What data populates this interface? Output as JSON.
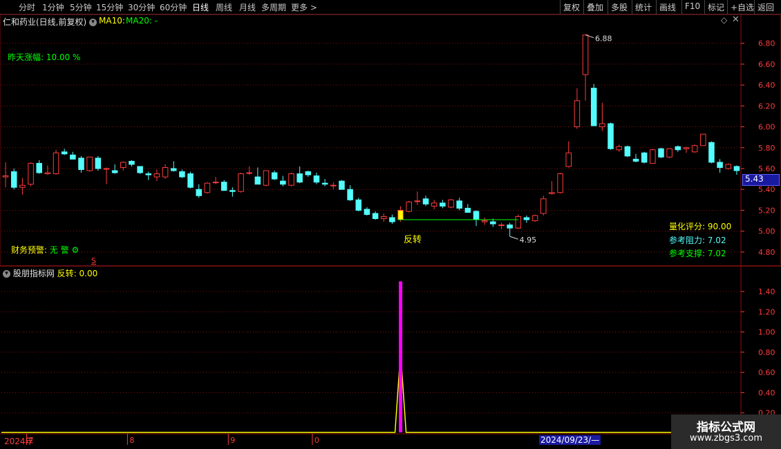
{
  "toolbar": {
    "timeframes": [
      "分时",
      "1分钟",
      "5分钟",
      "15分钟",
      "30分钟",
      "60分钟",
      "日线",
      "周线",
      "月线",
      "多周期",
      "更多 >"
    ],
    "active_timeframe": "日线",
    "buttons": [
      "复权",
      "叠加",
      "多股",
      "统计",
      "画线",
      "F10",
      "标记",
      "+自选",
      "返回"
    ]
  },
  "main_panel": {
    "stock_title": "仁和药业(日线,前复权)",
    "ma10_label": "MA10:",
    "ma20_label": "MA20: -",
    "prev_change_label": "昨天涨幅:",
    "prev_change_value": "10.00 %",
    "finance_warning_label": "财务预警:",
    "finance_warning_value": "无 警",
    "reversal_label": "反转",
    "quant_score": "量化评分: 90.00",
    "resistance": "参考阻力: 7.02",
    "support": "参考支撑: 7.02",
    "current_price_tag": "5.43"
  },
  "sub_panel": {
    "title": "股朋指标网",
    "indicator": "反转: 0.00"
  },
  "date_axis": {
    "year": "2024年",
    "months": [
      "7",
      "8",
      "9",
      "0"
    ],
    "cursor_date": "2024/09/23/—"
  },
  "watermark": {
    "line1": "指标公式网",
    "line2": "www.zbgs3.com"
  },
  "colors": {
    "up": "#ff3c3c",
    "down": "#54fcfc",
    "grid": "#8a1010",
    "axis_text": "#ff3c3c",
    "yellow": "#ffff00",
    "green": "#00ff00",
    "magenta": "#ff00ff"
  },
  "chart_data": {
    "type": "candlestick",
    "ylim": [
      4.7,
      6.95
    ],
    "y_ticks": [
      4.8,
      5.0,
      5.2,
      5.4,
      5.6,
      5.8,
      6.0,
      6.2,
      6.4,
      6.6,
      6.8
    ],
    "annotations": {
      "high": "6.88",
      "low": "4.95"
    },
    "candles": [
      {
        "o": 5.52,
        "h": 5.66,
        "l": 5.42,
        "c": 5.53
      },
      {
        "o": 5.57,
        "h": 5.6,
        "l": 5.4,
        "c": 5.42
      },
      {
        "o": 5.42,
        "h": 5.51,
        "l": 5.35,
        "c": 5.44
      },
      {
        "o": 5.45,
        "h": 5.66,
        "l": 5.43,
        "c": 5.65
      },
      {
        "o": 5.65,
        "h": 5.68,
        "l": 5.55,
        "c": 5.56
      },
      {
        "o": 5.55,
        "h": 5.63,
        "l": 5.54,
        "c": 5.56
      },
      {
        "o": 5.55,
        "h": 5.78,
        "l": 5.54,
        "c": 5.75
      },
      {
        "o": 5.76,
        "h": 5.79,
        "l": 5.73,
        "c": 5.74
      },
      {
        "o": 5.73,
        "h": 5.76,
        "l": 5.69,
        "c": 5.69
      },
      {
        "o": 5.7,
        "h": 5.72,
        "l": 5.56,
        "c": 5.59
      },
      {
        "o": 5.58,
        "h": 5.71,
        "l": 5.57,
        "c": 5.71
      },
      {
        "o": 5.7,
        "h": 5.72,
        "l": 5.58,
        "c": 5.6
      },
      {
        "o": 5.6,
        "h": 5.61,
        "l": 5.45,
        "c": 5.6
      },
      {
        "o": 5.58,
        "h": 5.64,
        "l": 5.55,
        "c": 5.56
      },
      {
        "o": 5.61,
        "h": 5.67,
        "l": 5.58,
        "c": 5.66
      },
      {
        "o": 5.67,
        "h": 5.68,
        "l": 5.62,
        "c": 5.64
      },
      {
        "o": 5.62,
        "h": 5.62,
        "l": 5.55,
        "c": 5.56
      },
      {
        "o": 5.55,
        "h": 5.57,
        "l": 5.49,
        "c": 5.54
      },
      {
        "o": 5.52,
        "h": 5.59,
        "l": 5.48,
        "c": 5.55
      },
      {
        "o": 5.52,
        "h": 5.64,
        "l": 5.5,
        "c": 5.61
      },
      {
        "o": 5.6,
        "h": 5.67,
        "l": 5.57,
        "c": 5.58
      },
      {
        "o": 5.57,
        "h": 5.59,
        "l": 5.51,
        "c": 5.52
      },
      {
        "o": 5.55,
        "h": 5.57,
        "l": 5.41,
        "c": 5.42
      },
      {
        "o": 5.4,
        "h": 5.45,
        "l": 5.32,
        "c": 5.34
      },
      {
        "o": 5.37,
        "h": 5.47,
        "l": 5.36,
        "c": 5.46
      },
      {
        "o": 5.47,
        "h": 5.52,
        "l": 5.45,
        "c": 5.47
      },
      {
        "o": 5.47,
        "h": 5.49,
        "l": 5.4,
        "c": 5.39
      },
      {
        "o": 5.39,
        "h": 5.42,
        "l": 5.33,
        "c": 5.38
      },
      {
        "o": 5.38,
        "h": 5.56,
        "l": 5.37,
        "c": 5.55
      },
      {
        "o": 5.56,
        "h": 5.62,
        "l": 5.54,
        "c": 5.56
      },
      {
        "o": 5.52,
        "h": 5.61,
        "l": 5.5,
        "c": 5.45
      },
      {
        "o": 5.44,
        "h": 5.58,
        "l": 5.43,
        "c": 5.58
      },
      {
        "o": 5.56,
        "h": 5.58,
        "l": 5.49,
        "c": 5.5
      },
      {
        "o": 5.48,
        "h": 5.53,
        "l": 5.43,
        "c": 5.45
      },
      {
        "o": 5.44,
        "h": 5.56,
        "l": 5.43,
        "c": 5.55
      },
      {
        "o": 5.55,
        "h": 5.62,
        "l": 5.46,
        "c": 5.47
      },
      {
        "o": 5.57,
        "h": 5.58,
        "l": 5.52,
        "c": 5.54
      },
      {
        "o": 5.53,
        "h": 5.56,
        "l": 5.45,
        "c": 5.47
      },
      {
        "o": 5.46,
        "h": 5.5,
        "l": 5.43,
        "c": 5.45
      },
      {
        "o": 5.44,
        "h": 5.47,
        "l": 5.4,
        "c": 5.44
      },
      {
        "o": 5.48,
        "h": 5.49,
        "l": 5.4,
        "c": 5.4
      },
      {
        "o": 5.4,
        "h": 5.44,
        "l": 5.29,
        "c": 5.3
      },
      {
        "o": 5.3,
        "h": 5.32,
        "l": 5.19,
        "c": 5.2
      },
      {
        "o": 5.21,
        "h": 5.23,
        "l": 5.15,
        "c": 5.16
      },
      {
        "o": 5.17,
        "h": 5.19,
        "l": 5.11,
        "c": 5.12
      },
      {
        "o": 5.12,
        "h": 5.17,
        "l": 5.09,
        "c": 5.14
      },
      {
        "o": 5.13,
        "h": 5.16,
        "l": 5.07,
        "c": 5.09
      },
      {
        "o": 5.11,
        "h": 5.24,
        "l": 5.09,
        "c": 5.2
      },
      {
        "o": 5.19,
        "h": 5.29,
        "l": 5.18,
        "c": 5.28
      },
      {
        "o": 5.29,
        "h": 5.38,
        "l": 5.25,
        "c": 5.29
      },
      {
        "o": 5.31,
        "h": 5.34,
        "l": 5.24,
        "c": 5.26
      },
      {
        "o": 5.24,
        "h": 5.3,
        "l": 5.21,
        "c": 5.27
      },
      {
        "o": 5.27,
        "h": 5.3,
        "l": 5.22,
        "c": 5.24
      },
      {
        "o": 5.23,
        "h": 5.31,
        "l": 5.22,
        "c": 5.3
      },
      {
        "o": 5.29,
        "h": 5.32,
        "l": 5.2,
        "c": 5.22
      },
      {
        "o": 5.22,
        "h": 5.26,
        "l": 5.18,
        "c": 5.18
      },
      {
        "o": 5.19,
        "h": 5.2,
        "l": 5.05,
        "c": 5.11
      },
      {
        "o": 5.09,
        "h": 5.13,
        "l": 5.06,
        "c": 5.1
      },
      {
        "o": 5.09,
        "h": 5.12,
        "l": 5.04,
        "c": 5.07
      },
      {
        "o": 5.06,
        "h": 5.08,
        "l": 5.02,
        "c": 5.06
      },
      {
        "o": 5.06,
        "h": 5.08,
        "l": 4.95,
        "c": 5.03
      },
      {
        "o": 5.03,
        "h": 5.16,
        "l": 5.02,
        "c": 5.14
      },
      {
        "o": 5.13,
        "h": 5.15,
        "l": 5.08,
        "c": 5.11
      },
      {
        "o": 5.1,
        "h": 5.16,
        "l": 5.09,
        "c": 5.15
      },
      {
        "o": 5.17,
        "h": 5.34,
        "l": 5.15,
        "c": 5.31
      },
      {
        "o": 5.36,
        "h": 5.48,
        "l": 5.35,
        "c": 5.37
      },
      {
        "o": 5.37,
        "h": 5.56,
        "l": 5.36,
        "c": 5.55
      },
      {
        "o": 5.62,
        "h": 5.86,
        "l": 5.61,
        "c": 5.75
      },
      {
        "o": 6.0,
        "h": 6.37,
        "l": 5.98,
        "c": 6.25
      },
      {
        "o": 6.5,
        "h": 6.88,
        "l": 6.25,
        "c": 6.88
      },
      {
        "o": 6.37,
        "h": 6.41,
        "l": 6.01,
        "c": 6.01
      },
      {
        "o": 6.0,
        "h": 6.23,
        "l": 5.96,
        "c": 6.03
      },
      {
        "o": 6.03,
        "h": 6.04,
        "l": 5.78,
        "c": 5.79
      },
      {
        "o": 5.78,
        "h": 5.83,
        "l": 5.76,
        "c": 5.81
      },
      {
        "o": 5.81,
        "h": 5.82,
        "l": 5.71,
        "c": 5.72
      },
      {
        "o": 5.69,
        "h": 5.74,
        "l": 5.66,
        "c": 5.67
      },
      {
        "o": 5.75,
        "h": 5.76,
        "l": 5.65,
        "c": 5.66
      },
      {
        "o": 5.65,
        "h": 5.79,
        "l": 5.65,
        "c": 5.78
      },
      {
        "o": 5.79,
        "h": 5.8,
        "l": 5.7,
        "c": 5.71
      },
      {
        "o": 5.71,
        "h": 5.79,
        "l": 5.7,
        "c": 5.79
      },
      {
        "o": 5.81,
        "h": 5.82,
        "l": 5.76,
        "c": 5.78
      },
      {
        "o": 5.79,
        "h": 5.81,
        "l": 5.75,
        "c": 5.8
      },
      {
        "o": 5.76,
        "h": 5.83,
        "l": 5.75,
        "c": 5.82
      },
      {
        "o": 5.82,
        "h": 5.93,
        "l": 5.82,
        "c": 5.93
      },
      {
        "o": 5.85,
        "h": 5.86,
        "l": 5.65,
        "c": 5.66
      },
      {
        "o": 5.66,
        "h": 5.69,
        "l": 5.56,
        "c": 5.61
      },
      {
        "o": 5.6,
        "h": 5.65,
        "l": 5.59,
        "c": 5.64
      },
      {
        "o": 5.62,
        "h": 5.63,
        "l": 5.54,
        "c": 5.58
      }
    ],
    "signal_index": 47,
    "indicator": {
      "type": "bar",
      "ylim": [
        0,
        1.55
      ],
      "y_ticks": [
        0.2,
        0.4,
        0.6,
        0.8,
        1.0,
        1.2,
        1.4,
        1.6
      ],
      "signal_value": 1.5,
      "line_peak": 0.8
    }
  }
}
